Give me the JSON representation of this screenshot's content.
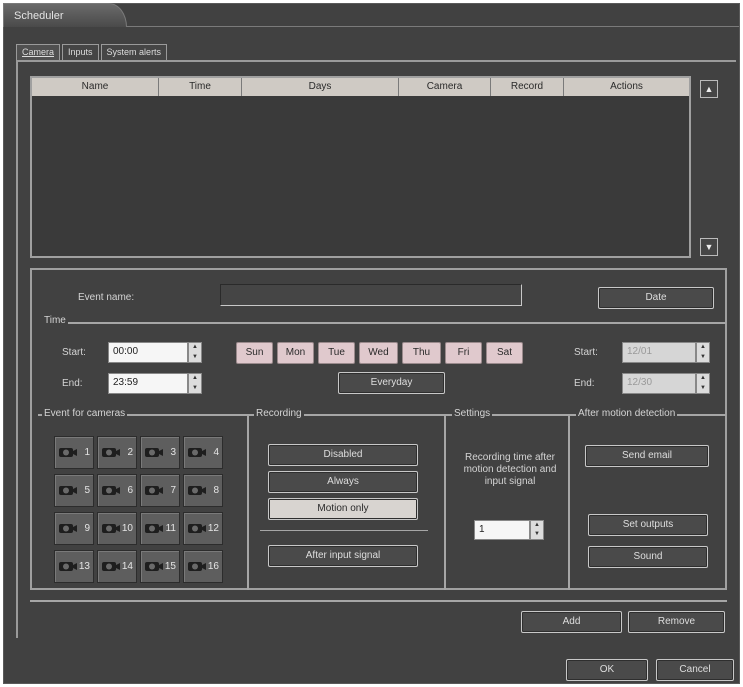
{
  "window": {
    "title": "Scheduler"
  },
  "tabs": [
    {
      "label": "Camera"
    },
    {
      "label": "Inputs"
    },
    {
      "label": "System alerts"
    }
  ],
  "table": {
    "columns": [
      "Name",
      "Time",
      "Days",
      "Camera",
      "Record",
      "Actions"
    ],
    "rows": []
  },
  "event": {
    "name_label": "Event name:",
    "name_value": "",
    "date_button": "Date"
  },
  "time": {
    "group_label": "Time",
    "start_label": "Start:",
    "start_value": "00:00",
    "end_label": "End:",
    "end_value": "23:59",
    "days": [
      "Sun",
      "Mon",
      "Tue",
      "Wed",
      "Thu",
      "Fri",
      "Sat"
    ],
    "everyday_button": "Everyday",
    "date_start_label": "Start:",
    "date_start_value": "12/01",
    "date_end_label": "End:",
    "date_end_value": "12/30"
  },
  "cameras": {
    "group_label": "Event for cameras",
    "numbers": [
      "1",
      "2",
      "3",
      "4",
      "5",
      "6",
      "7",
      "8",
      "9",
      "10",
      "11",
      "12",
      "13",
      "14",
      "15",
      "16"
    ]
  },
  "recording": {
    "group_label": "Recording",
    "disabled": "Disabled",
    "always": "Always",
    "motion_only": "Motion only",
    "selected": "Motion only",
    "after_input": "After input signal"
  },
  "settings": {
    "group_label": "Settings",
    "description": "Recording time after motion detection and input signal",
    "value": "1"
  },
  "after_motion": {
    "group_label": "After motion detection",
    "send_email": "Send email",
    "set_outputs": "Set outputs",
    "sound": "Sound"
  },
  "actions": {
    "add": "Add",
    "remove": "Remove"
  },
  "dialog": {
    "ok": "OK",
    "cancel": "Cancel"
  }
}
